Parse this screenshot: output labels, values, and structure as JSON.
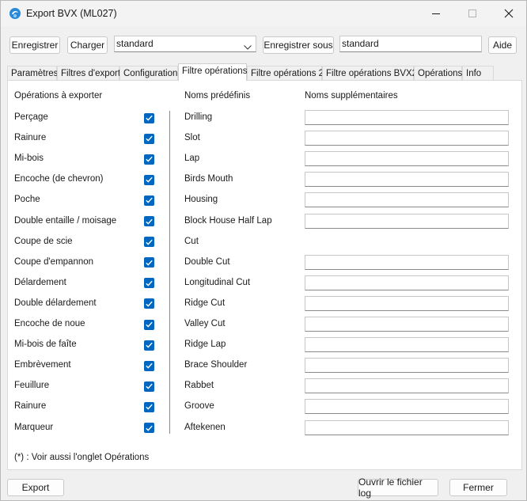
{
  "window": {
    "title": "Export BVX (ML027)",
    "accent_color": "#0067c0"
  },
  "toolbar": {
    "save_label": "Enregistrer",
    "load_label": "Charger",
    "preset_selected": "standard",
    "save_as_label": "Enregistrer sous",
    "save_as_name": "standard",
    "help_label": "Aide"
  },
  "tabs": [
    {
      "label": "Paramètres",
      "active": false
    },
    {
      "label": "Filtres d'export",
      "active": false
    },
    {
      "label": "Configuration",
      "active": false
    },
    {
      "label": "Filtre opérations",
      "active": true
    },
    {
      "label": "Filtre opérations 2",
      "active": false
    },
    {
      "label": "Filtre opérations BVX2",
      "active": false
    },
    {
      "label": "Opérations",
      "active": false
    },
    {
      "label": "Info",
      "active": false
    }
  ],
  "columns": {
    "operations": "Opérations à exporter",
    "predefined": "Noms prédéfinis",
    "additional": "Noms supplémentaires"
  },
  "operations": [
    {
      "name": "Perçage",
      "predefined": "Drilling",
      "checked": true,
      "has_field": true,
      "extra": ""
    },
    {
      "name": "Rainure",
      "predefined": "Slot",
      "checked": true,
      "has_field": true,
      "extra": ""
    },
    {
      "name": "Mi-bois",
      "predefined": "Lap",
      "checked": true,
      "has_field": true,
      "extra": ""
    },
    {
      "name": "Encoche (de chevron)",
      "predefined": "Birds Mouth",
      "checked": true,
      "has_field": true,
      "extra": ""
    },
    {
      "name": "Poche",
      "predefined": "Housing",
      "checked": true,
      "has_field": true,
      "extra": ""
    },
    {
      "name": "Double entaille / moisage",
      "predefined": "Block House Half Lap",
      "checked": true,
      "has_field": true,
      "extra": ""
    },
    {
      "name": "Coupe de scie",
      "predefined": "Cut",
      "checked": true,
      "has_field": false,
      "extra": ""
    },
    {
      "name": "Coupe d'empannon",
      "predefined": "Double Cut",
      "checked": true,
      "has_field": true,
      "extra": ""
    },
    {
      "name": "Délardement",
      "predefined": "Longitudinal Cut",
      "checked": true,
      "has_field": true,
      "extra": ""
    },
    {
      "name": "Double délardement",
      "predefined": "Ridge Cut",
      "checked": true,
      "has_field": true,
      "extra": ""
    },
    {
      "name": "Encoche de noue",
      "predefined": "Valley Cut",
      "checked": true,
      "has_field": true,
      "extra": ""
    },
    {
      "name": "Mi-bois de faîte",
      "predefined": "Ridge Lap",
      "checked": true,
      "has_field": true,
      "extra": ""
    },
    {
      "name": "Embrèvement",
      "predefined": "Brace Shoulder",
      "checked": true,
      "has_field": true,
      "extra": ""
    },
    {
      "name": "Feuillure",
      "predefined": "Rabbet",
      "checked": true,
      "has_field": true,
      "extra": ""
    },
    {
      "name": "Rainure",
      "predefined": "Groove",
      "checked": true,
      "has_field": true,
      "extra": ""
    },
    {
      "name": "Marqueur",
      "predefined": "Aftekenen",
      "checked": true,
      "has_field": true,
      "extra": ""
    }
  ],
  "footnote": "(*) : Voir aussi l'onglet Opérations",
  "footer": {
    "export_label": "Export",
    "open_log_label": "Ouvrir le fichier log",
    "close_label": "Fermer"
  }
}
